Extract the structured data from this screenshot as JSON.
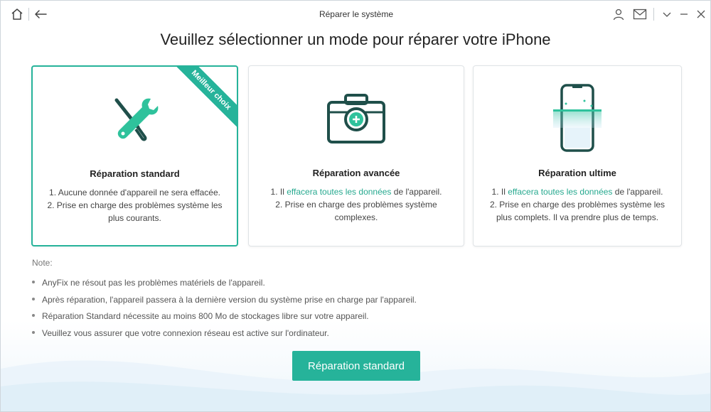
{
  "window": {
    "title": "Réparer le système"
  },
  "heading": "Veuillez sélectionner un mode pour réparer votre iPhone",
  "cards": [
    {
      "title": "Réparation standard",
      "ribbon": "Meilleur choix",
      "lines": [
        {
          "parts": [
            "1. Aucune donnée d'appareil ne sera effacée."
          ]
        },
        {
          "parts": [
            "2. Prise en charge des problèmes système les plus courants."
          ]
        }
      ]
    },
    {
      "title": "Réparation avancée",
      "line1_pre": "1. Il ",
      "line1_hl": "effacera toutes les données",
      "line1_post": " de l'appareil.",
      "line2": "2. Prise en charge des problèmes système complexes."
    },
    {
      "title": "Réparation ultime",
      "line1_pre": "1. Il ",
      "line1_hl": "effacera toutes les données",
      "line1_post": " de l'appareil.",
      "line2": "2. Prise en charge des problèmes système les plus complets. Il va prendre plus de temps."
    }
  ],
  "notes": {
    "title": "Note:",
    "items": [
      "AnyFix ne résout pas les problèmes matériels de l'appareil.",
      "Après réparation, l'appareil passera à la dernière version du système prise en charge par l'appareil.",
      "Réparation Standard nécessite au moins 800 Mo de stockages libre sur votre appareil.",
      "Veuillez vous assurer que votre connexion réseau est active sur l'ordinateur."
    ]
  },
  "primary_button": "Réparation standard",
  "colors": {
    "accent": "#26b39a",
    "icon_dark": "#1f4f4a",
    "highlight_text": "#26a98f"
  },
  "icons": {
    "home": "home-icon",
    "back": "back-arrow-icon",
    "user": "user-icon",
    "mail": "mail-icon",
    "minimize": "chevron-down-icon",
    "min2": "minimize-icon",
    "close": "close-icon"
  }
}
